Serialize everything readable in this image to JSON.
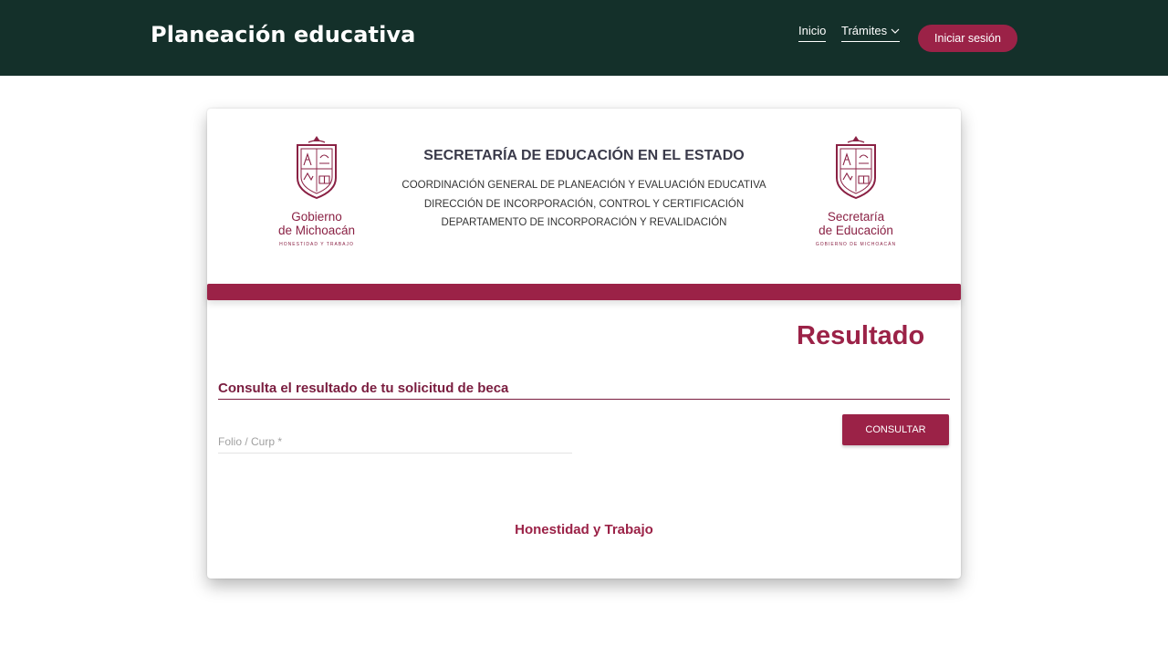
{
  "header": {
    "brand": "Planeación educativa",
    "nav": {
      "inicio": "Inicio",
      "tramites": "Trámites"
    },
    "login": "Iniciar sesión"
  },
  "card": {
    "logo_left": {
      "line1": "Gobierno",
      "line2": "de Michoacán",
      "tagline": "HONESTIDAD Y TRABAJO"
    },
    "logo_right": {
      "line1": "Secretaría",
      "line2": "de Educación",
      "tagline": "GOBIERNO DE MICHOACÁN"
    },
    "heading": {
      "title": "SECRETARÍA DE EDUCACIÓN EN EL ESTADO",
      "line1": "COORDINACIÓN GENERAL DE PLANEACIÓN Y EVALUACIÓN EDUCATIVA",
      "line2": "DIRECCIÓN DE INCORPORACIÓN, CONTROL Y CERTIFICACIÓN",
      "line3": "DEPARTAMENTO DE INCORPORACIÓN Y REVALIDACIÓN"
    },
    "result_title": "Resultado",
    "section_title": "Consulta el resultado de tu solicitud de beca",
    "form": {
      "field_placeholder": "Folio / Curp *",
      "field_value": "",
      "button": "CONSULTAR"
    },
    "motto": "Honestidad y Trabajo"
  },
  "colors": {
    "topbar": "#14302a",
    "accent": "#9b2247",
    "accent_dark": "#7a1d3f"
  },
  "icons": [
    "chevron-down-icon",
    "coat-of-arms-icon"
  ]
}
